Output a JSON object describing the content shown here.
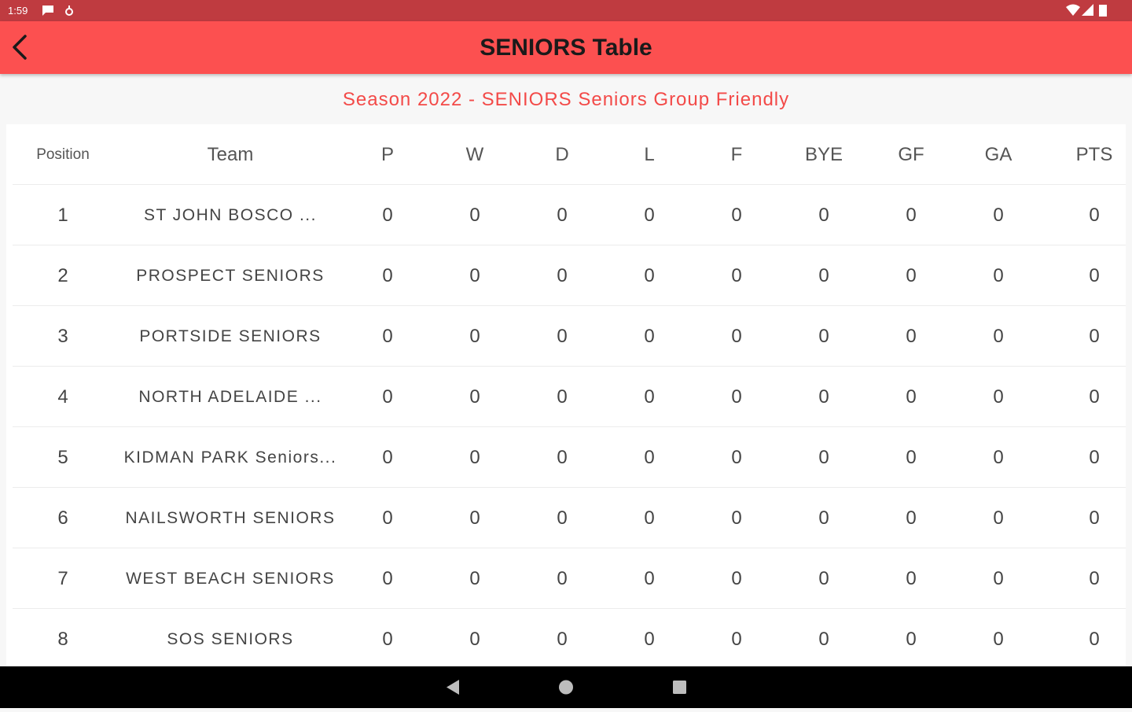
{
  "status_bar": {
    "time": "1:59"
  },
  "app_bar": {
    "title": "SENIORS Table"
  },
  "subtitle": "Season 2022 - SENIORS Seniors Group Friendly",
  "table": {
    "columns": [
      "Position",
      "Team",
      "P",
      "W",
      "D",
      "L",
      "F",
      "BYE",
      "GF",
      "GA",
      "PTS"
    ],
    "rows": [
      {
        "position": "1",
        "team": "ST JOHN BOSCO ...",
        "p": "0",
        "w": "0",
        "d": "0",
        "l": "0",
        "f": "0",
        "bye": "0",
        "gf": "0",
        "ga": "0",
        "pts": "0"
      },
      {
        "position": "2",
        "team": "PROSPECT SENIORS",
        "p": "0",
        "w": "0",
        "d": "0",
        "l": "0",
        "f": "0",
        "bye": "0",
        "gf": "0",
        "ga": "0",
        "pts": "0"
      },
      {
        "position": "3",
        "team": "PORTSIDE SENIORS",
        "p": "0",
        "w": "0",
        "d": "0",
        "l": "0",
        "f": "0",
        "bye": "0",
        "gf": "0",
        "ga": "0",
        "pts": "0"
      },
      {
        "position": "4",
        "team": "NORTH ADELAIDE ...",
        "p": "0",
        "w": "0",
        "d": "0",
        "l": "0",
        "f": "0",
        "bye": "0",
        "gf": "0",
        "ga": "0",
        "pts": "0"
      },
      {
        "position": "5",
        "team": "KIDMAN PARK Seniors...",
        "p": "0",
        "w": "0",
        "d": "0",
        "l": "0",
        "f": "0",
        "bye": "0",
        "gf": "0",
        "ga": "0",
        "pts": "0"
      },
      {
        "position": "6",
        "team": "NAILSWORTH SENIORS",
        "p": "0",
        "w": "0",
        "d": "0",
        "l": "0",
        "f": "0",
        "bye": "0",
        "gf": "0",
        "ga": "0",
        "pts": "0"
      },
      {
        "position": "7",
        "team": "WEST BEACH SENIORS",
        "p": "0",
        "w": "0",
        "d": "0",
        "l": "0",
        "f": "0",
        "bye": "0",
        "gf": "0",
        "ga": "0",
        "pts": "0"
      },
      {
        "position": "8",
        "team": "SOS SENIORS",
        "p": "0",
        "w": "0",
        "d": "0",
        "l": "0",
        "f": "0",
        "bye": "0",
        "gf": "0",
        "ga": "0",
        "pts": "0"
      }
    ]
  },
  "icons": {
    "back": "back-arrow-icon",
    "nav_back": "nav-back-icon",
    "nav_home": "nav-home-icon",
    "nav_recents": "nav-recents-icon"
  },
  "colors": {
    "status_bar": "#bf3b40",
    "app_bar": "#fc5050",
    "subtitle": "#f34a48",
    "nav_bar": "#000000"
  }
}
